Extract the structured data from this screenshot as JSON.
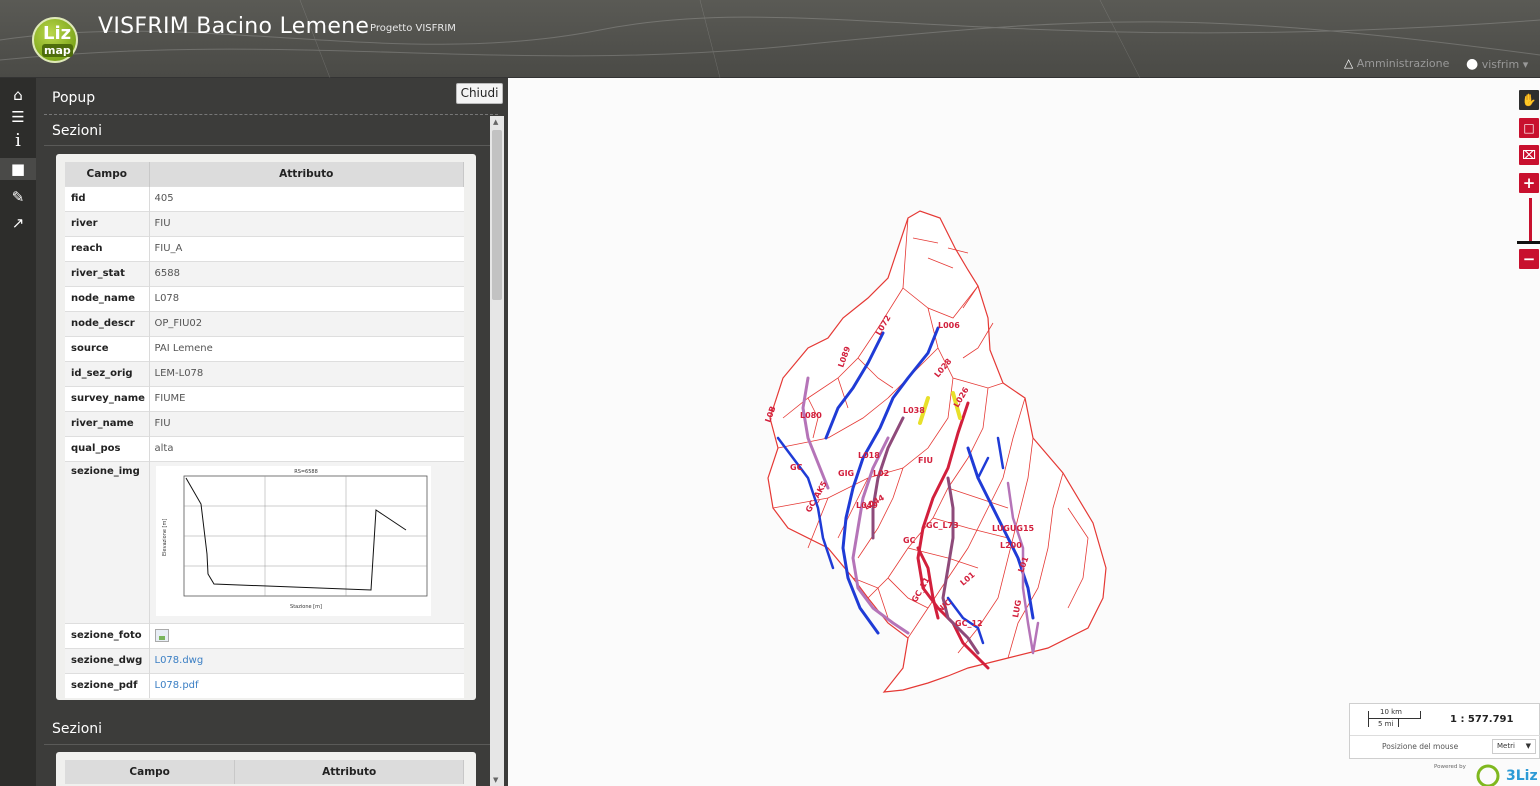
{
  "header": {
    "logo_top": "Liz",
    "logo_bottom": "map",
    "title": "VISFRIM Bacino Lemene",
    "subtitle": "Progetto VISFRIM",
    "admin_label": "Amministrazione",
    "user_label": "visfrim"
  },
  "sidebar": {
    "items": [
      {
        "icon": "home-icon"
      },
      {
        "icon": "layers-icon"
      },
      {
        "icon": "info-icon"
      },
      {
        "icon": "popup-icon"
      },
      {
        "icon": "measure-icon"
      },
      {
        "icon": "share-icon"
      }
    ]
  },
  "popup": {
    "title": "Popup",
    "close_label": "Chiudi",
    "sections": [
      {
        "title": "Sezioni",
        "col_field": "Campo",
        "col_value": "Attributo",
        "rows": [
          {
            "k": "fid",
            "v": "405"
          },
          {
            "k": "river",
            "v": "FIU"
          },
          {
            "k": "reach",
            "v": "FIU_A"
          },
          {
            "k": "river_stat",
            "v": "6588"
          },
          {
            "k": "node_name",
            "v": "L078"
          },
          {
            "k": "node_descr",
            "v": "OP_FIU02"
          },
          {
            "k": "source",
            "v": "PAI Lemene"
          },
          {
            "k": "id_sez_orig",
            "v": "LEM-L078"
          },
          {
            "k": "survey_name",
            "v": "FIUME"
          },
          {
            "k": "river_name",
            "v": "FIU"
          },
          {
            "k": "qual_pos",
            "v": "alta"
          },
          {
            "k": "sezione_img",
            "v": ""
          },
          {
            "k": "sezione_foto",
            "v": ""
          },
          {
            "k": "sezione_dwg",
            "v": "L078.dwg"
          },
          {
            "k": "sezione_pdf",
            "v": "L078.pdf"
          }
        ],
        "plot": {
          "title": "RS=6588",
          "xlabel": "Stazione [m]",
          "ylabel": "Elevazione [m]"
        }
      },
      {
        "title": "Sezioni",
        "col_field": "Campo",
        "col_value": "Attributo"
      }
    ]
  },
  "map": {
    "scale_km": "10 km",
    "scale_mi": "5 mi",
    "scale_ratio": "1 : 577.791",
    "mouse_position_label": "Posizione del mouse",
    "units": "Metri",
    "powered_by": "Powered by",
    "brand": "3Liz",
    "labels": [
      "L006",
      "L072",
      "L089",
      "L028",
      "L080",
      "L038",
      "L026",
      "L018",
      "GC",
      "GIG",
      "L02",
      "L049",
      "L044",
      "GC_AK5",
      "GC_L73",
      "GC",
      "LUGUG15",
      "L200",
      "L01",
      "GC_11",
      "L01",
      "NIC",
      "GC_12",
      "LUG",
      "L0B",
      "FIU"
    ],
    "accent_red": "#c8102e",
    "boundary_color": "#e53935",
    "river_colors": [
      "#1f3bd6",
      "#d21f3c",
      "#b574b8",
      "#e8e02a",
      "#8e4a7a"
    ]
  }
}
